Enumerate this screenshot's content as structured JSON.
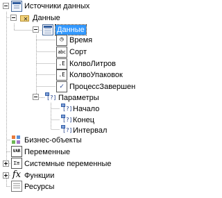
{
  "tree": {
    "root": {
      "label": "Источники данных",
      "expanded": true,
      "icon": "datasource-icon"
    },
    "connection": {
      "label": "Данные",
      "expanded": true,
      "icon": "folder-delete-icon"
    },
    "table": {
      "label": "Данные",
      "expanded": true,
      "selected": true,
      "icon": "table-icon"
    },
    "columns": [
      {
        "label": "Время",
        "icon": "time-icon",
        "glyph": "◷"
      },
      {
        "label": "Сорт",
        "icon": "string-icon",
        "glyph": "abc"
      },
      {
        "label": "КолвоЛитров",
        "icon": "number-icon",
        "glyph": ".E"
      },
      {
        "label": "КолвоУпаковок",
        "icon": "number-icon",
        "glyph": ".E"
      },
      {
        "label": "ПроцессЗавершен",
        "icon": "boolean-icon",
        "glyph": "✓"
      }
    ],
    "params_group": {
      "label": "Параметры",
      "expanded": true,
      "icon": "parameters-icon"
    },
    "params": [
      {
        "label": "Начало",
        "icon": "parameter-icon"
      },
      {
        "label": "Конец",
        "icon": "parameter-icon"
      },
      {
        "label": "Интервал",
        "icon": "parameter-icon"
      }
    ],
    "top_items": [
      {
        "label": "Бизнес-объекты",
        "icon": "business-objects-icon",
        "expandable": false,
        "glyph": ""
      },
      {
        "label": "Переменные",
        "icon": "variable-icon",
        "expandable": false,
        "glyph": "VAR"
      },
      {
        "label": "Системные переменные",
        "icon": "system-variable-icon",
        "expandable": true,
        "glyph": "Σ≡"
      },
      {
        "label": "Функции",
        "icon": "function-icon",
        "expandable": true,
        "glyph": "fx"
      },
      {
        "label": "Ресурсы",
        "icon": "resources-icon",
        "expandable": false,
        "glyph": ""
      }
    ]
  },
  "colors": {
    "selection": "#3399ff",
    "lines": "#a0a0a0"
  }
}
